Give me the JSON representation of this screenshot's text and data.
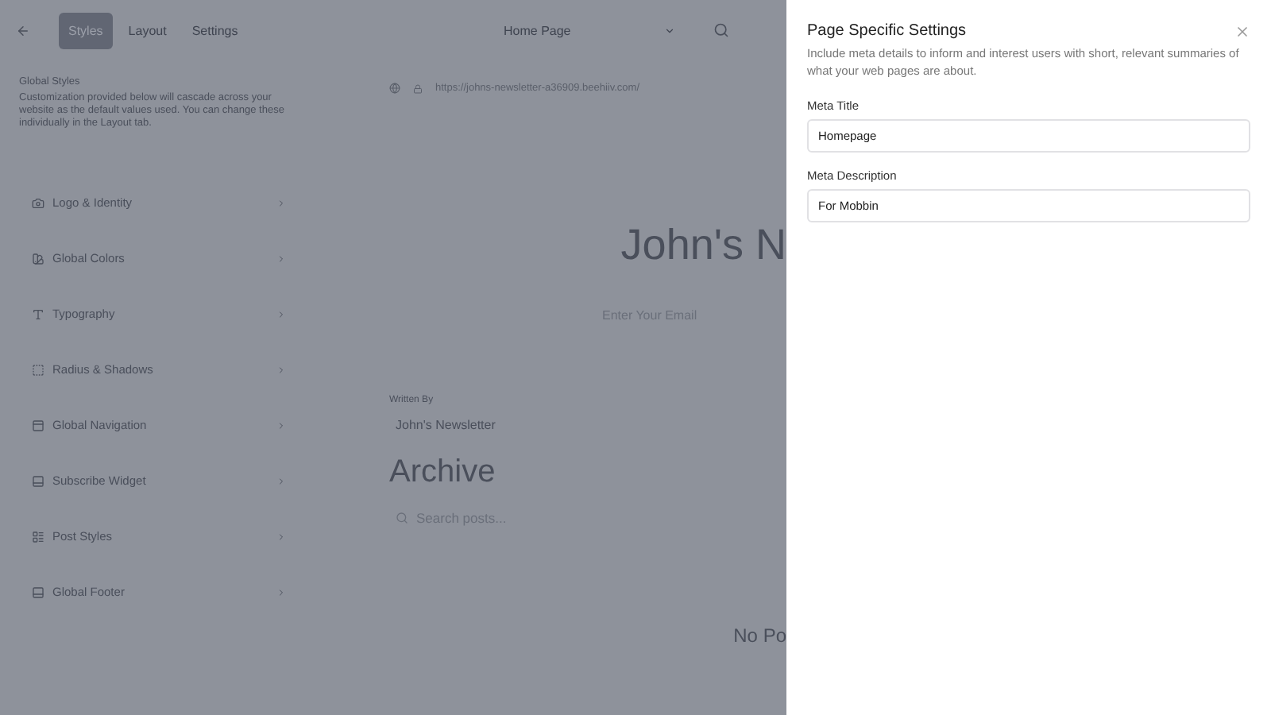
{
  "toolbar": {
    "tabs": [
      {
        "label": "Styles",
        "selected": true
      },
      {
        "label": "Layout",
        "selected": false
      },
      {
        "label": "Settings",
        "selected": false
      }
    ],
    "page_select": {
      "value": "Home Page"
    }
  },
  "sidebar": {
    "title": "Global Styles",
    "description": "Customization provided below will cascade across your website as the default values used. You can change these individually in the Layout tab.",
    "items": [
      {
        "label": "Logo & Identity"
      },
      {
        "label": "Global Colors"
      },
      {
        "label": "Typography"
      },
      {
        "label": "Radius & Shadows"
      },
      {
        "label": "Global Navigation"
      },
      {
        "label": "Subscribe Widget"
      },
      {
        "label": "Post Styles"
      },
      {
        "label": "Global Footer"
      }
    ]
  },
  "preview": {
    "url": "https://johns-newsletter-a36909.beehiiv.com/",
    "heading": "John's N",
    "email_placeholder": "Enter Your Email",
    "written_by_label": "Written By",
    "author": "John's Newsletter",
    "archive_title": "Archive",
    "search_placeholder": "Search posts...",
    "empty_text": "No Po"
  },
  "drawer": {
    "title": "Page Specific Settings",
    "description": "Include meta details to inform and interest users with short, relevant summaries of what your web pages are about.",
    "fields": [
      {
        "label": "Meta Title",
        "value": "Homepage"
      },
      {
        "label": "Meta Description",
        "value": "For Mobbin"
      }
    ]
  }
}
